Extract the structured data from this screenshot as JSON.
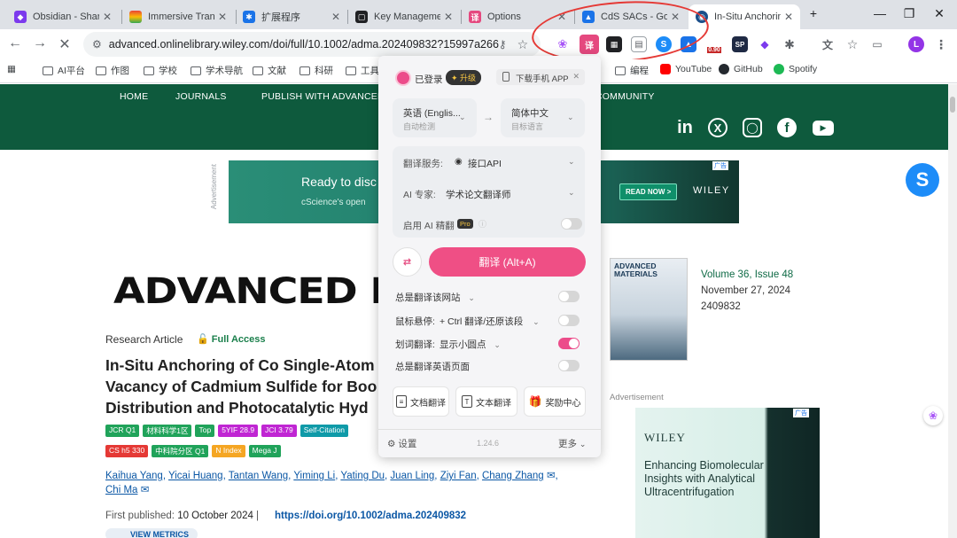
{
  "browser": {
    "tabs": [
      {
        "title": "Obsidian - Shar",
        "fav_color": "#7c3aed"
      },
      {
        "title": "Immersive Tran",
        "fav_color": "#ea4335"
      },
      {
        "title": "扩展程序",
        "fav_color": "#1a73e8"
      },
      {
        "title": "Key Manageme",
        "fav_color": "#202124"
      },
      {
        "title": "Options",
        "fav_color": "#e5497f"
      },
      {
        "title": "CdS SACs - Go",
        "fav_color": "#1a73e8"
      },
      {
        "title": "In-Situ Anchorin",
        "fav_color": "#1b4f8a"
      }
    ],
    "new_tab": "+",
    "window_controls": {
      "minimize": "—",
      "restore": "❐",
      "close": "✕"
    },
    "url": "advanced.onlinelibrary.wiley.com/doi/full/10.1002/adma.202409832?15997a266...",
    "profile_letter": "L",
    "ext_badge": "0.90",
    "bookmarks": [
      {
        "label": "AI平台",
        "kind": "folder"
      },
      {
        "label": "作图",
        "kind": "folder"
      },
      {
        "label": "学校",
        "kind": "folder"
      },
      {
        "label": "学术导航",
        "kind": "folder"
      },
      {
        "label": "文献",
        "kind": "folder"
      },
      {
        "label": "科研",
        "kind": "folder"
      },
      {
        "label": "工具",
        "kind": "folder"
      },
      {
        "label": "编程",
        "kind": "folder"
      },
      {
        "label": "YouTube",
        "kind": "site",
        "color": "#ff0000"
      },
      {
        "label": "GitHub",
        "kind": "site",
        "color": "#24292f"
      },
      {
        "label": "Spotify",
        "kind": "site",
        "color": "#1db954"
      }
    ]
  },
  "site": {
    "nav": [
      "HOME",
      "JOURNALS",
      "PUBLISH WITH ADVANCED",
      "COMMUNITY"
    ],
    "ad_label": "Advertisement",
    "ad1": {
      "text": "Ready to disc",
      "sub": "cScience's open",
      "cta": "READ NOW >",
      "brand": "WILEY",
      "tag": "广告"
    },
    "journal_title": "ADVANCED MA",
    "cover_title": "ADVANCED MATERIALS",
    "volume": "Volume 36, Issue 48",
    "date": "November 27, 2024",
    "article_no": "2409832",
    "article_type": "Research Article",
    "full_access": "Full Access",
    "article_title": "In-Situ Anchoring of Co Single-Atom Vacancy of Cadmium Sulfide for Boo Distribution and Photocatalytic Hyd",
    "badges_row1": [
      {
        "label": "JCR Q1",
        "color": "#20a35a"
      },
      {
        "label": "材料科学1区",
        "color": "#20a35a"
      },
      {
        "label": "Top",
        "color": "#20a35a"
      },
      {
        "label": "5YIF 28.9",
        "color": "#c026d3"
      },
      {
        "label": "JCI 3.79",
        "color": "#c026d3"
      },
      {
        "label": "Self-Citation",
        "color": "#0f9aa8"
      }
    ],
    "badges_row2": [
      {
        "label": "CS h5 330",
        "color": "#e53935"
      },
      {
        "label": "中科院分区 Q1",
        "color": "#20a35a"
      },
      {
        "label": "N Index",
        "color": "#f5a623"
      },
      {
        "label": "Mega J",
        "color": "#20a35a"
      }
    ],
    "authors": [
      "Kaihua Yang",
      "Yicai Huang",
      "Tantan Wang",
      "Yiming Li",
      "Yating Du",
      "Juan Ling",
      "Ziyi Fan",
      "Chang Zhang",
      "Chi Ma"
    ],
    "first_published_label": "First published:",
    "first_published": "10 October 2024",
    "doi": "https://doi.org/10.1002/adma.202409832",
    "view_metrics": "VIEW METRICS",
    "ad2": {
      "tag": "广告",
      "brand": "WILEY",
      "text": "Enhancing Biomolecular Insights with Analytical Ultracentrifugation"
    }
  },
  "popup": {
    "status": "已登录",
    "upgrade": "升级",
    "download_app": "下载手机 APP",
    "source_lang": "英语 (Englis...",
    "source_sub": "自动检测",
    "target_lang": "简体中文",
    "target_sub": "目标语言",
    "service_label": "翻译服务:",
    "service_value": "接口API",
    "expert_label": "AI 专家:",
    "expert_value": "学术论文翻译师",
    "ai_refine_label": "启用 AI 精翻",
    "pro": "Pro",
    "translate_button": "翻译 (Alt+A)",
    "always_translate_site": "总是翻译该网站",
    "hover_label": "鼠标悬停:",
    "hover_value": "+ Ctrl 翻译/还原该段",
    "select_label": "划词翻译:",
    "select_value": "显示小圆点",
    "always_translate_english": "总是翻译英语页面",
    "tools": [
      "文档翻译",
      "文本翻译",
      "奖励中心"
    ],
    "settings": "设置",
    "version": "1.24.6",
    "more": "更多"
  },
  "states": {
    "always_site": false,
    "hover": false,
    "select": true,
    "always_english": false,
    "ai_refine": false
  }
}
